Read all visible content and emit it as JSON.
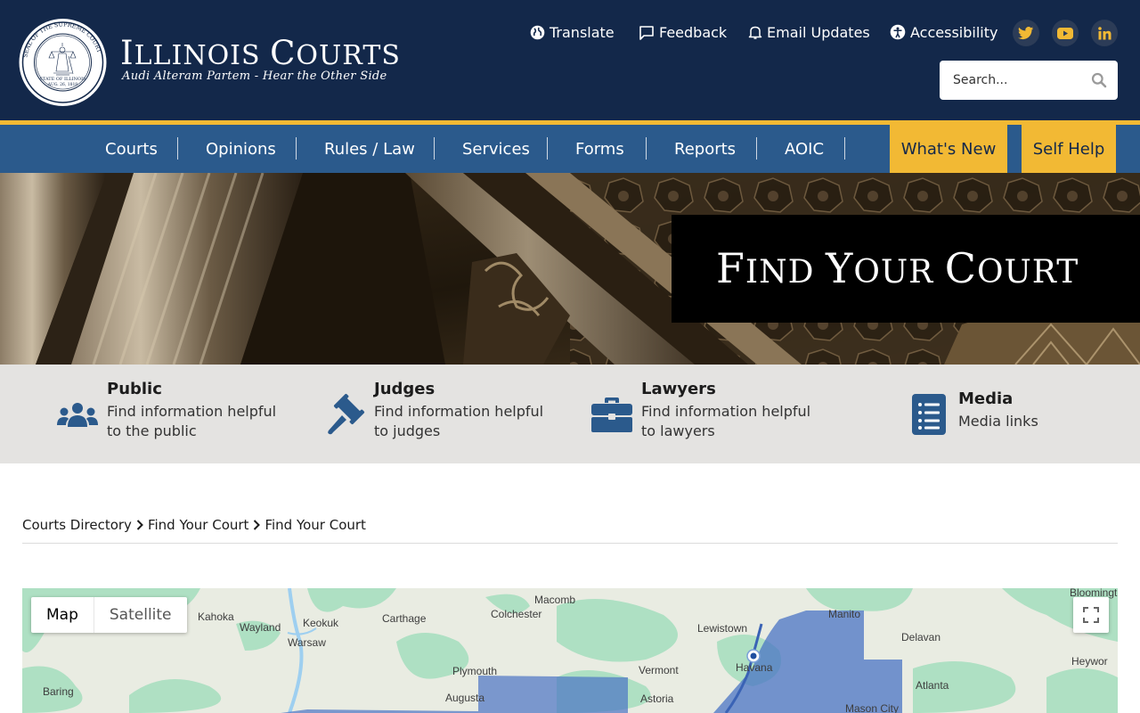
{
  "brand": {
    "title_first": "I",
    "title_rest": "LLINOIS ",
    "title_second": "C",
    "title_second_rest": "OURTS",
    "tagline": "Audi Alteram Partem - Hear the Other Side",
    "seal_text": "SEAL OF THE SUPREME COURT",
    "seal_state": "STATE OF ILLINOIS",
    "seal_date": "AUG. 26, 1818"
  },
  "utility": {
    "translate": "Translate",
    "feedback": "Feedback",
    "email_updates": "Email Updates",
    "accessibility": "Accessibility"
  },
  "social": [
    "twitter-icon",
    "youtube-icon",
    "linkedin-icon"
  ],
  "search": {
    "placeholder": "Search..."
  },
  "nav": {
    "items": [
      "Courts",
      "Opinions",
      "Rules / Law",
      "Services",
      "Forms",
      "Reports",
      "AOIC"
    ],
    "whats_new": "What's New",
    "self_help": "Self Help"
  },
  "hero": {
    "title_f": "F",
    "title_ind": "IND ",
    "title_y": "Y",
    "title_our": "OUR ",
    "title_c": "C",
    "title_ourt": "OURT"
  },
  "audience": [
    {
      "title": "Public",
      "line1": "Find information helpful",
      "line2": "to the public",
      "icon": "people-icon"
    },
    {
      "title": "Judges",
      "line1": "Find information helpful",
      "line2": "to judges",
      "icon": "gavel-icon"
    },
    {
      "title": "Lawyers",
      "line1": "Find information helpful",
      "line2": "to lawyers",
      "icon": "briefcase-icon"
    },
    {
      "title": "Media",
      "line1": "Media links",
      "icon": "list-icon"
    }
  ],
  "breadcrumb": [
    "Courts Directory",
    "Find Your Court",
    "Find Your Court"
  ],
  "map": {
    "map_label": "Map",
    "satellite_label": "Satellite",
    "towns": [
      "Macomb",
      "Bloomingt",
      "Kahoka",
      "Colchester",
      "Manito",
      "Wayland",
      "Keokuk",
      "Carthage",
      "Lewistown",
      "Delavan",
      "Warsaw",
      "Havana",
      "Heywor",
      "Plymouth",
      "Vermont",
      "Baring",
      "Augusta",
      "Astoria",
      "Atlanta",
      "Mason City"
    ],
    "colors": {
      "land": "#e9ece2",
      "green": "#a8dfc0",
      "river": "#9ecff0",
      "district": "#4a74c4"
    }
  },
  "colors": {
    "header": "#13284a",
    "nav": "#2b5a8c",
    "accent": "#f2b934",
    "icon_blue": "#2b5a8c"
  }
}
